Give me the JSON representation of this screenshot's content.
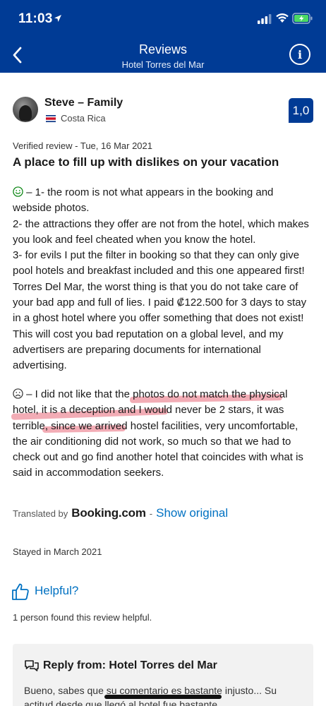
{
  "status_bar": {
    "time": "11:03"
  },
  "header": {
    "title": "Reviews",
    "subtitle": "Hotel Torres del Mar"
  },
  "reviewer": {
    "name": "Steve – Family",
    "country": "Costa Rica",
    "score": "1,0"
  },
  "review": {
    "verified_line": "Verified review - Tue, 16 Mar 2021",
    "title": "A place to fill up with dislikes on your vacation",
    "positive_text": " –  1- the room is not what appears in the booking and webside photos.\n2- the attractions they offer are not from the hotel, which makes you look and feel cheated when you know the hotel.\n3- for evils I put the filter in booking so that they can only give pool hotels and breakfast included and this one appeared first! Torres Del Mar, the worst thing is that you do not take care of your bad app and full of lies. I paid ₡122.500 for 3 days to stay in a ghost hotel where you offer something that does not exist! This will cost you bad reputation on a global level, and my advertisers are preparing documents for international advertising.",
    "negative_text": " –  I did not like that the photos do not match the physical hotel, it is a deception and I would never be 2 stars, it was terrible, since we arrived hostel facilities, very uncomfortable, the air conditioning did not work, so much so that we had to check out and go find another hotel that coincides with what is said in accommodation seekers."
  },
  "translation": {
    "translated_by": "Translated by",
    "brand": "Booking.com",
    "separator": "-",
    "show_original": "Show original"
  },
  "stayed": "Stayed in March 2021",
  "helpful": {
    "button_label": "Helpful?",
    "count_text": "1 person found this review helpful."
  },
  "reply": {
    "title": "Reply from: Hotel Torres del Mar",
    "text": "Bueno, sabes que su comentario es bastante injusto... Su actitud desde que llegó al hotel fue bastante"
  },
  "colors": {
    "brand_blue": "#003b95",
    "link_blue": "#0071c2",
    "positive_green": "#008009",
    "highlight": "#e86878"
  },
  "icons": [
    "location-arrow-icon",
    "signal-icon",
    "wifi-icon",
    "battery-icon",
    "back-chevron-icon",
    "info-icon",
    "costa-rica-flag-icon",
    "smile-icon",
    "frown-icon",
    "thumbs-up-icon",
    "chat-bubbles-icon"
  ]
}
